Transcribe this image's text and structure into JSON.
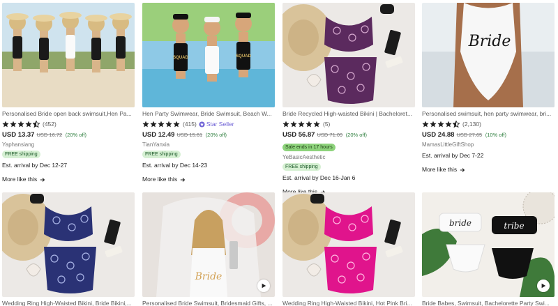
{
  "colors": {
    "star": "#222222",
    "discount": "#2f7f3f",
    "star_seller": "#6f62d6",
    "sale_badge": "#8ed37c",
    "ship_badge": "#d6f0d3"
  },
  "listings": [
    {
      "title": "Personalised Bride open back swimsuit,Hen Pa...",
      "stars": 4.5,
      "rating_count": "(452)",
      "price": "USD 13.37",
      "original_price": "USD 16.72",
      "discount": "(20% off)",
      "shop": "Yaphansiang",
      "free_shipping": "FREE shipping",
      "arrival": "Est. arrival by Dec 12-27",
      "more_like_this": "More like this"
    },
    {
      "title": "Hen Party Swimwear, Bride Swimsuit, Beach W...",
      "stars": 5,
      "rating_count": "(415)",
      "star_seller": "Star Seller",
      "price": "USD 12.49",
      "original_price": "USD 15.61",
      "discount": "(20% off)",
      "shop": "TianYanxia",
      "free_shipping": "FREE shipping",
      "arrival": "Est. arrival by Dec 14-23",
      "more_like_this": "More like this"
    },
    {
      "title": "Bride Recycled High-waisted Bikini | Bacheloret...",
      "stars": 5,
      "rating_count": "(5)",
      "price": "USD 56.87",
      "original_price": "USD 71.09",
      "discount": "(20% off)",
      "sale_badge": "Sale ends in 17 hours",
      "shop": "YeBasicAesthetic",
      "free_shipping": "FREE shipping",
      "arrival": "Est. arrival by Dec 16-Jan 6",
      "more_like_this": "More like this"
    },
    {
      "title": "Personalised swimsuit, hen party swimwear, bri...",
      "stars": 4.5,
      "rating_count": "(2,130)",
      "price": "USD 24.88",
      "original_price": "USD 27.65",
      "discount": "(10% off)",
      "shop": "MamasLittleGiftShop",
      "arrival": "Est. arrival by Dec 7-22",
      "more_like_this": "More like this"
    },
    {
      "title": "Wedding Ring High-Waisted Bikini, Bride Bikini,..."
    },
    {
      "title": "Personalised Bride Swimsuit, Bridesmaid Gifts, ..."
    },
    {
      "title": "Wedding Ring High-Waisted Bikini, Hot Pink Bri..."
    },
    {
      "title": "Bride Babes, Swimsuit, Bachelorette Party Swi..."
    }
  ],
  "image_text": {
    "bride_script": "Bride",
    "bride_lower": "bride",
    "tribe_lower": "tribe",
    "squad": "SQUAD",
    "bride_squad": "BRIDE SQUAD"
  }
}
